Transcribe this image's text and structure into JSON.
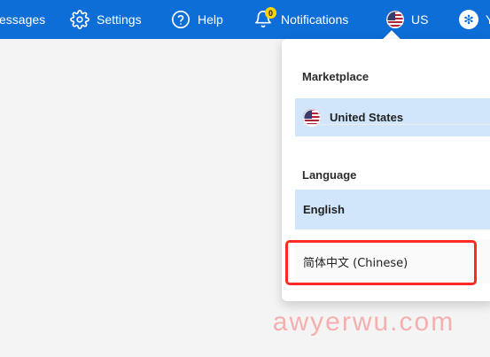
{
  "header": {
    "messages_label": "essages",
    "settings_label": "Settings",
    "help_label": "Help",
    "notifications_label": "Notifications",
    "notifications_count": "0",
    "locale_label": "US",
    "account_label": "Y"
  },
  "dropdown": {
    "marketplace_title": "Marketplace",
    "marketplace_selected": "United States",
    "language_title": "Language",
    "language_options": [
      {
        "label": "English",
        "selected": true
      },
      {
        "label": "简体中文 (Chinese)",
        "selected": false
      }
    ]
  },
  "overlay": {
    "watermark": "awyerwu.com"
  },
  "colors": {
    "header_bg": "#0d6ed8",
    "selected_option": "#d1e6fb",
    "highlight_border": "#ff2a25",
    "badge_bg": "#ffd400"
  },
  "icons": {
    "settings": "gear-icon",
    "help": "question-circle-icon",
    "notifications": "bell-icon",
    "locale": "us-flag-icon",
    "account": "asterisk-icon"
  }
}
